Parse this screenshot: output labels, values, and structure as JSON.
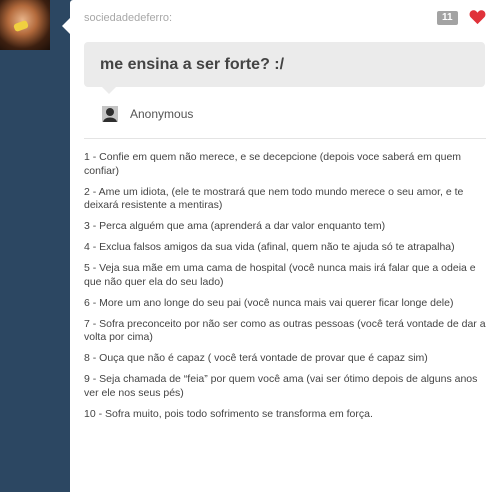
{
  "post": {
    "username": "sociedadedeferro:",
    "note_count": "11",
    "icons": {
      "avatar": "blog-avatar",
      "like": "heart-icon",
      "asker": "anonymous-avatar-icon"
    },
    "colors": {
      "background": "#2c4762",
      "heart": "#e0323a",
      "question_bg": "#ebebeb"
    }
  },
  "question": {
    "text": "me ensina a ser forte? :/",
    "asker": "Anonymous"
  },
  "answer": {
    "items": [
      "1 - Confie em quem não merece, e se decepcione (depois voce saberá em quem confiar)",
      "2 - Ame um idiota, (ele te mostrará que nem todo mundo merece o seu amor, e te deixará resistente a mentiras)",
      "3 - Perca alguém que ama (aprenderá a dar valor enquanto tem)",
      "4 - Exclua falsos amigos da sua vida (afinal, quem não te ajuda só te atrapalha)",
      "5 - Veja sua mãe em uma cama de hospital (você nunca mais irá falar que a odeia e que não quer ela do seu lado)",
      "6 - More um ano longe do seu pai (você nunca mais vai querer ficar longe dele)",
      "7 - Sofra preconceito por não ser como as outras pessoas (você terá vontade de dar a volta por cima)",
      "8 - Ouça que não é capaz ( você terá vontade de provar que é capaz sim)",
      "9 - Seja chamada de “feia” por quem você ama (vai ser ótimo depois de alguns anos ver ele nos seus pés)",
      "10 - Sofra muito, pois todo sofrimento se transforma em força."
    ]
  }
}
